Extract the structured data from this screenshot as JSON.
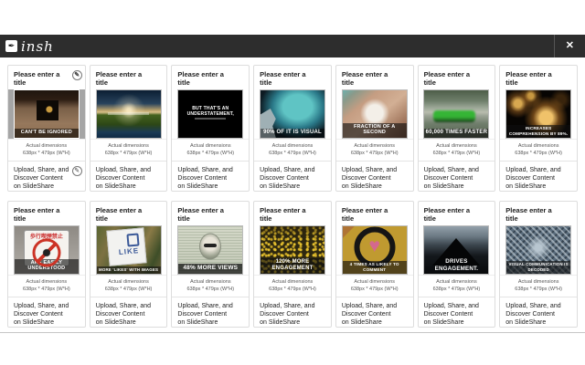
{
  "icons": {
    "edit": "✎",
    "close": "✕",
    "pen": "✒"
  },
  "header": {
    "logo_text": "insh"
  },
  "card_defaults": {
    "title_placeholder": "Please enter a title",
    "dimensions_label": "Actual dimensions",
    "dimensions_value": "638px * 479px (W*H)",
    "description": "Upload, Share, and Discover Content on SlideShare"
  },
  "cards": [
    {
      "image": "binoculars-woman",
      "caption": "CAN'T BE IGNORED",
      "selected": true
    },
    {
      "image": "sky-landscape",
      "caption": ""
    },
    {
      "image": "black-quote",
      "caption": "BUT THAT'S AN UNDERSTATEMENT,"
    },
    {
      "image": "brain-scan",
      "caption": "90% OF IT IS VISUAL"
    },
    {
      "image": "hands-holding",
      "caption": "FRACTION OF A SECOND"
    },
    {
      "image": "race-car",
      "caption": "60,000 TIMES FASTER"
    },
    {
      "image": "light-bulbs",
      "caption": "INCREASES COMPREHENSION BY 89%."
    },
    {
      "image": "no-smoking-sign",
      "caption": "ARE EASILY UNDERSTOOD",
      "overlay": "歩行喫煙禁止"
    },
    {
      "image": "like-sign",
      "caption": "MORE 'LIKES' WITH IMAGES",
      "overlay": "LIKE"
    },
    {
      "image": "dollar-bill",
      "caption": "48% MORE VIEWS"
    },
    {
      "image": "stadium-crowd",
      "caption": "120% MORE ENGAGEMENT"
    },
    {
      "image": "heart-speech-bubble",
      "caption": "4 TIMES AS LIKELY TO COMMENT"
    },
    {
      "image": "mountain-silhouette",
      "caption": "DRIVES ENGAGEMENT."
    },
    {
      "image": "money-kaleidoscope",
      "caption": "VISUAL COMMUNICATION IS DECODED"
    }
  ]
}
